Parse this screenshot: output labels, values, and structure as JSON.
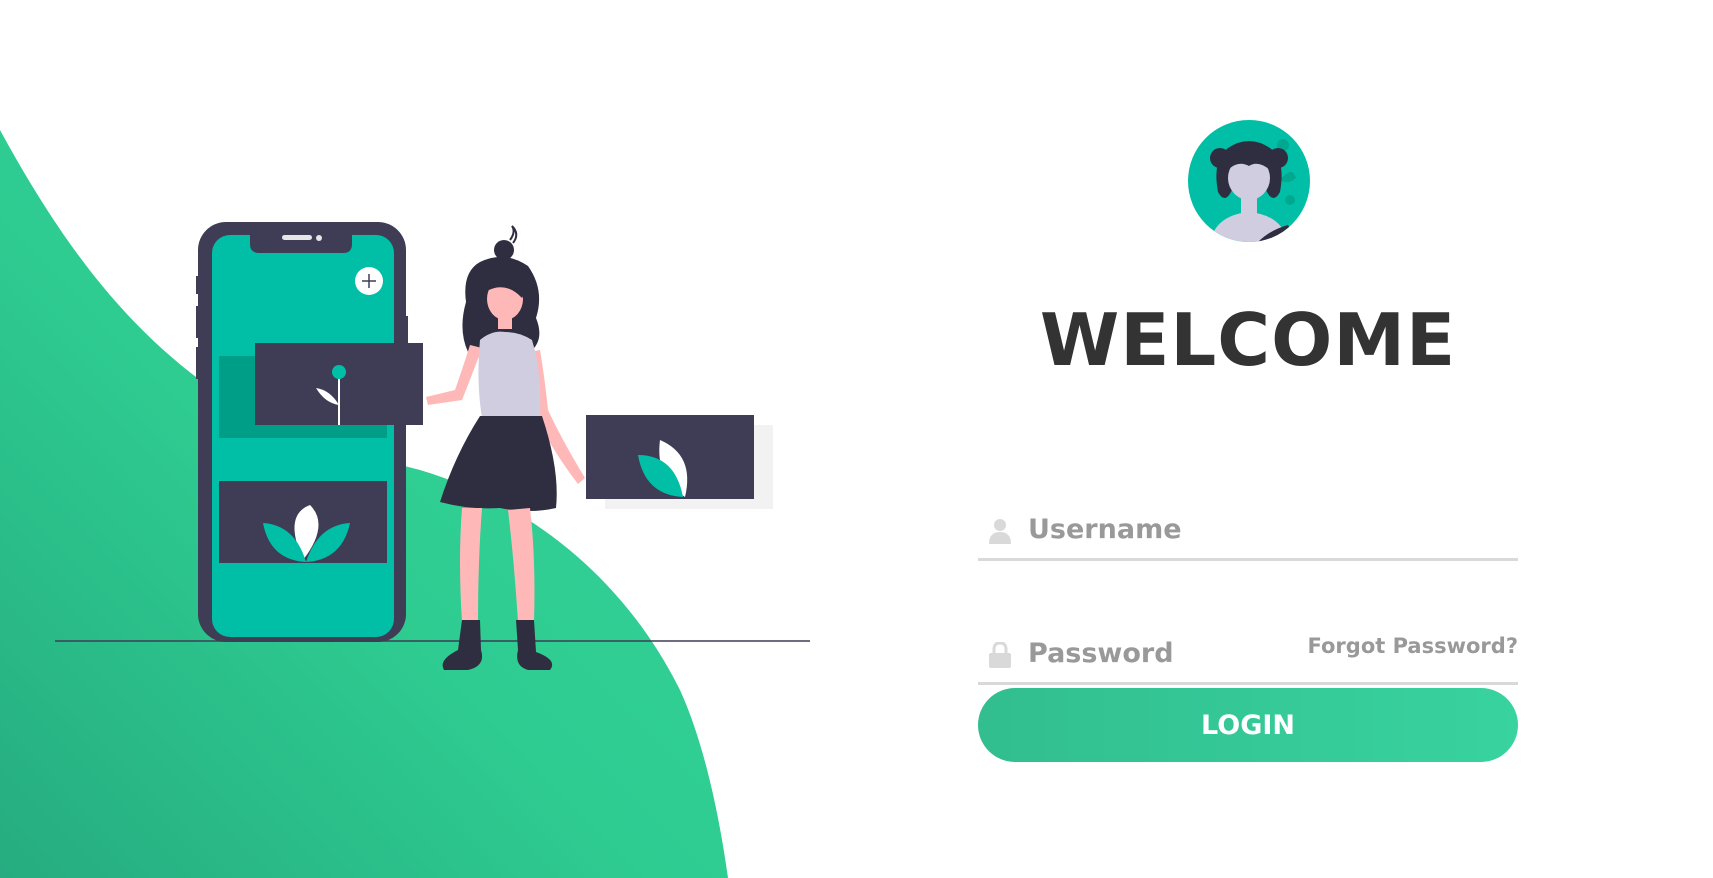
{
  "colors": {
    "accent": "#38d39f",
    "accent_dark": "#32be8f",
    "teal": "#00bfa6",
    "dark": "#3f3d56",
    "heading": "#333333",
    "placeholder": "#999999",
    "underline": "#d9d9d9"
  },
  "illustration": {
    "semantic": "woman-with-phone-illustration"
  },
  "login": {
    "title": "WELCOME",
    "username_placeholder": "Username",
    "password_placeholder": "Password",
    "forgot_label": "Forgot Password?",
    "login_label": "LOGIN"
  },
  "icons": {
    "username": "user-icon",
    "password": "lock-icon",
    "avatar": "avatar-icon"
  }
}
